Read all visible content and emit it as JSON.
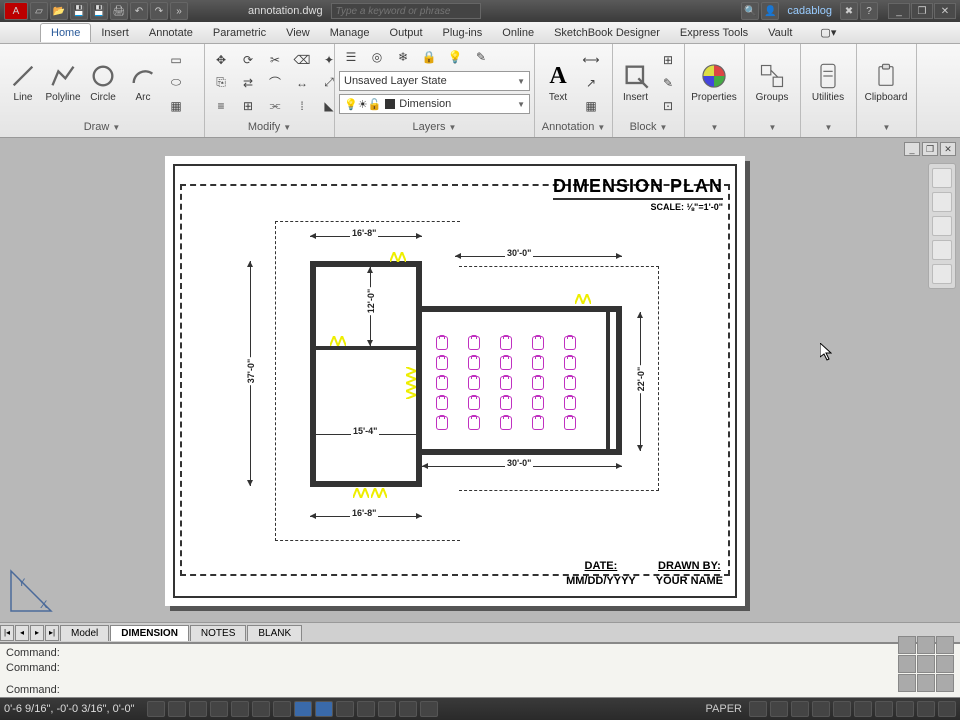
{
  "titlebar": {
    "filename": "annotation.dwg",
    "search_placeholder": "Type a keyword or phrase",
    "username": "cadablog"
  },
  "menu": {
    "tabs": [
      "Home",
      "Insert",
      "Annotate",
      "Parametric",
      "View",
      "Manage",
      "Output",
      "Plug-ins",
      "Online",
      "SketchBook Designer",
      "Express Tools",
      "Vault"
    ],
    "active": "Home"
  },
  "ribbon": {
    "draw": {
      "label": "Draw",
      "line": "Line",
      "polyline": "Polyline",
      "circle": "Circle",
      "arc": "Arc"
    },
    "modify": {
      "label": "Modify"
    },
    "layers": {
      "label": "Layers",
      "state": "Unsaved Layer State",
      "current": "Dimension"
    },
    "annotation": {
      "label": "Annotation",
      "text": "Text"
    },
    "block": {
      "label": "Block",
      "insert": "Insert"
    },
    "properties": {
      "label": "Properties"
    },
    "groups": {
      "label": "Groups"
    },
    "utilities": {
      "label": "Utilities"
    },
    "clipboard": {
      "label": "Clipboard"
    }
  },
  "drawing": {
    "title": "DIMENSION PLAN",
    "scale": "SCALE: ⅛\"=1'-0\"",
    "dims": {
      "d1": "16'-8\"",
      "d2": "30'-0\"",
      "d3": "12'-0\"",
      "d4": "37'-0\"",
      "d5": "15'-4\"",
      "d6": "22'-0\"",
      "d7": "30'-0\"",
      "d8": "16'-8\""
    },
    "titleblock": {
      "date_label": "DATE:",
      "date_value": "MM/DD/YYYY",
      "drawn_label": "DRAWN BY:",
      "drawn_value": "YOUR NAME"
    }
  },
  "layout_tabs": [
    "Model",
    "DIMENSION",
    "NOTES",
    "BLANK"
  ],
  "layout_active": "DIMENSION",
  "command": {
    "line1": "Command:",
    "line2": "Command:",
    "line3": "Command:"
  },
  "status": {
    "coords": "0'-6 9/16\", -0'-0 3/16\", 0'-0\"",
    "space": "PAPER"
  }
}
